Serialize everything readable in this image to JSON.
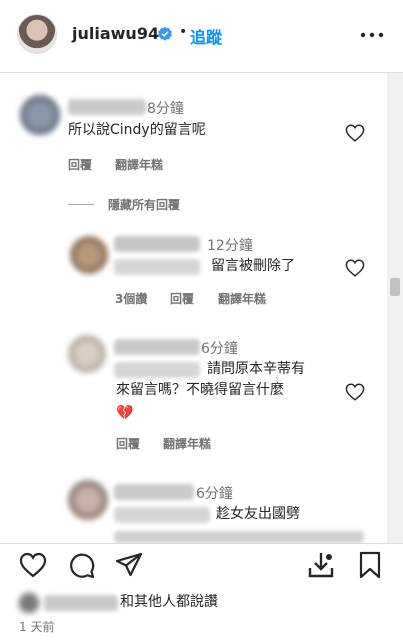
{
  "header": {
    "username": "juliawu94",
    "separator": "•",
    "follow_label": "追蹤"
  },
  "comments": [
    {
      "time": "8分鐘",
      "text": "所以說Cindy的留言呢",
      "reply_label": "回覆",
      "translate_label": "翻譯年糕"
    },
    {
      "hide_replies_label": "隱藏所有回覆"
    },
    {
      "time": "12分鐘",
      "text": "留言被刪除了",
      "likes_label": "3個讚",
      "reply_label": "回覆",
      "translate_label": "翻譯年糕"
    },
    {
      "time": "6分鐘",
      "text_line1": "請問原本辛蒂有",
      "text_line2": "來留言嗎？不曉得留言什麼",
      "emoji": "💔",
      "reply_label": "回覆",
      "translate_label": "翻譯年糕"
    },
    {
      "time": "6分鐘",
      "text_line1": "趁女友出國劈"
    }
  ],
  "footer": {
    "likes_suffix": "和其他人都說讚",
    "date": "1 天前"
  },
  "colors": {
    "accent": "#0095f6",
    "verified": "#3897f0",
    "muted": "#737373"
  },
  "icons": [
    "heart-icon",
    "comment-icon",
    "share-icon",
    "save-icon",
    "more-icon",
    "verified-icon",
    "broken-heart-icon"
  ]
}
